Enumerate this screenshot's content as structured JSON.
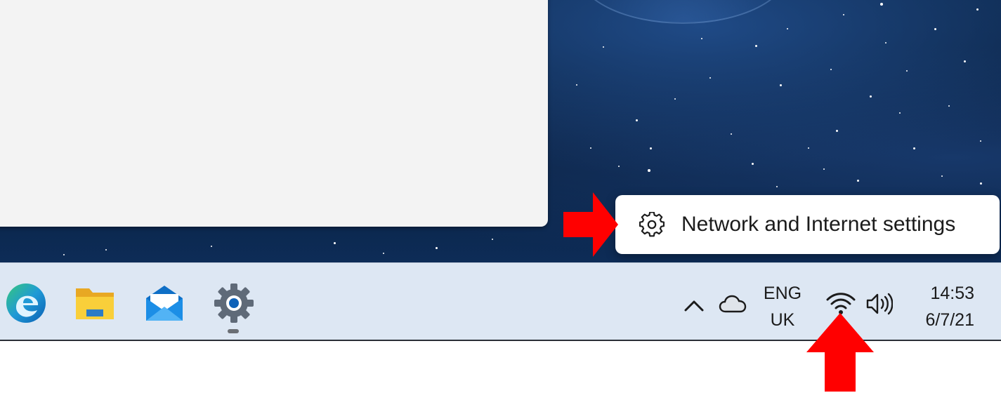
{
  "context_menu": {
    "items": [
      {
        "label": "Network and Internet settings",
        "icon": "gear-icon"
      }
    ]
  },
  "taskbar": {
    "apps": [
      {
        "name": "Microsoft Edge",
        "icon": "edge-icon"
      },
      {
        "name": "File Explorer",
        "icon": "folder-icon"
      },
      {
        "name": "Mail",
        "icon": "mail-icon"
      },
      {
        "name": "Settings",
        "icon": "gear-icon",
        "running": true
      }
    ],
    "tray": {
      "language_line1": "ENG",
      "language_line2": "UK",
      "time": "14:53",
      "date": "6/7/21"
    }
  },
  "colors": {
    "annotation_arrow": "#ff0000",
    "taskbar_bg": "#dde7f3",
    "menu_bg": "#ffffff",
    "window_bg": "#f3f3f3"
  }
}
